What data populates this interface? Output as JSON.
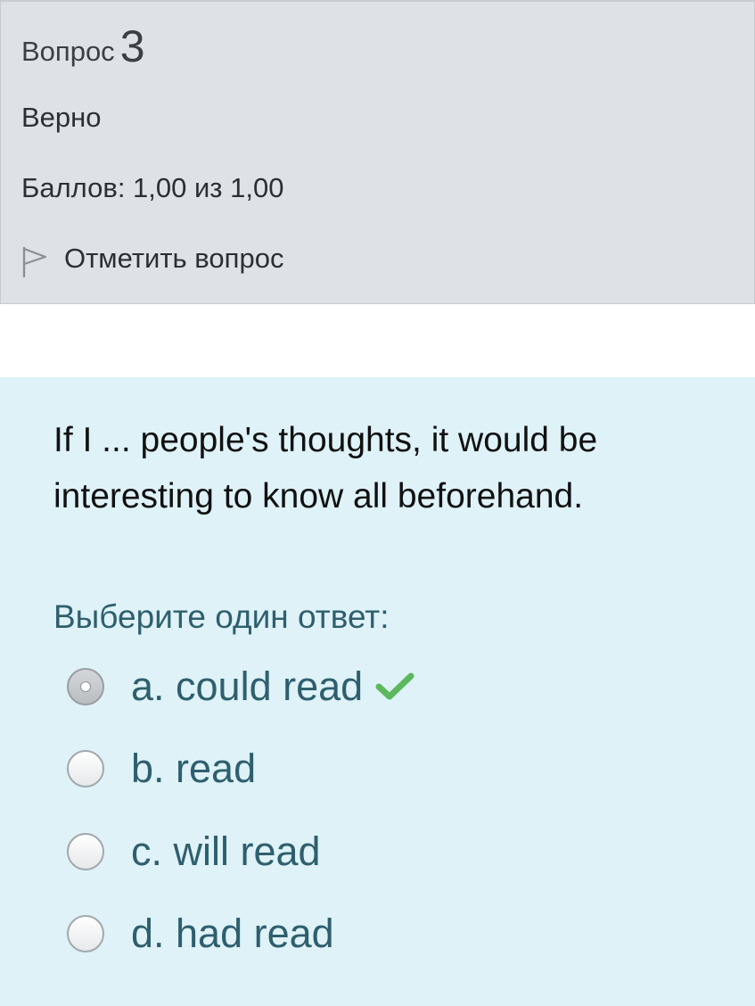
{
  "info": {
    "question_label": "Вопрос",
    "question_number": "3",
    "state": "Верно",
    "grade": "Баллов: 1,00 из 1,00",
    "flag_label": "Отметить вопрос"
  },
  "question": {
    "text": "If I ...  people's thoughts, it would be interesting to know all beforehand.",
    "prompt": "Выберите один ответ:",
    "answers": [
      {
        "label": "a. could read",
        "selected": true,
        "correct": true
      },
      {
        "label": "b. read",
        "selected": false
      },
      {
        "label": "c. will read",
        "selected": false
      },
      {
        "label": "d. had read",
        "selected": false
      }
    ]
  },
  "icons": {
    "flag": "flag-icon",
    "correct": "check-icon"
  },
  "colors": {
    "info_background": "#dee2e6",
    "formulation_background": "#def2f8",
    "answer_text": "#2f5f6e",
    "correct_check": "#5cb85c"
  }
}
